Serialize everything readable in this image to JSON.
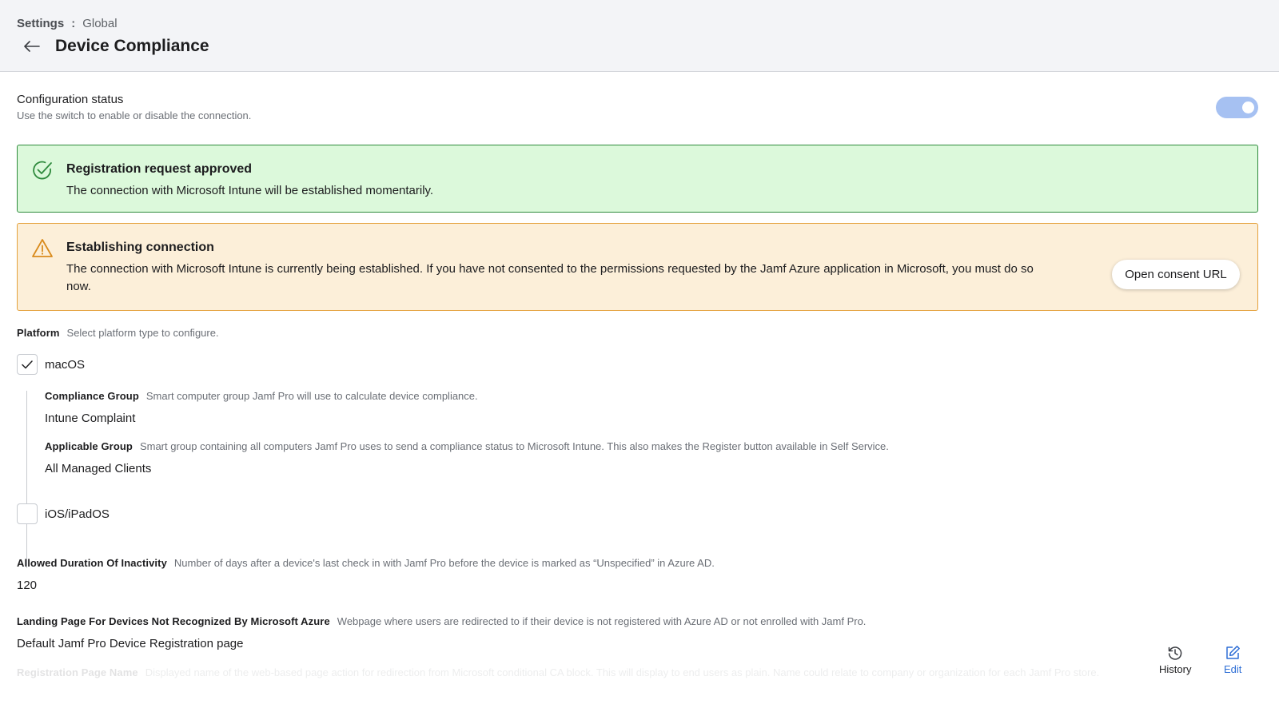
{
  "breadcrumb": {
    "root": "Settings",
    "separator": ":",
    "current": "Global"
  },
  "page": {
    "title": "Device Compliance"
  },
  "config_status": {
    "title": "Configuration status",
    "description": "Use the switch to enable or disable the connection.",
    "enabled": true
  },
  "alerts": {
    "success": {
      "title": "Registration request approved",
      "text": "The connection with Microsoft Intune will be established momentarily."
    },
    "warning": {
      "title": "Establishing connection",
      "text": "The connection with Microsoft Intune is currently being established. If you have not consented to the permissions requested by the Jamf Azure application in Microsoft, you must do so now.",
      "button_label": "Open consent URL"
    }
  },
  "platform": {
    "label": "Platform",
    "description": "Select platform type to configure.",
    "options": [
      {
        "label": "macOS",
        "checked": true
      },
      {
        "label": "iOS/iPadOS",
        "checked": false
      }
    ],
    "macos": {
      "compliance_group": {
        "label": "Compliance Group",
        "description": "Smart computer group Jamf Pro will use to calculate device compliance.",
        "value": "Intune Complaint"
      },
      "applicable_group": {
        "label": "Applicable Group",
        "description": "Smart group containing all computers Jamf Pro uses to send a compliance status to Microsoft Intune. This also makes the Register button available in Self Service.",
        "value": "All Managed Clients"
      }
    }
  },
  "inactivity": {
    "label": "Allowed Duration Of Inactivity",
    "description": "Number of days after a device's last check in with Jamf Pro before the device is marked as “Unspecified” in Azure AD.",
    "value": "120"
  },
  "landing_page": {
    "label": "Landing Page For Devices Not Recognized By Microsoft Azure",
    "description": "Webpage where users are redirected to if their device is not registered with Azure AD or not enrolled with Jamf Pro.",
    "value": "Default Jamf Pro Device Registration page"
  },
  "registration_page": {
    "label": "Registration Page Name",
    "description": "Displayed name of the web-based page action for redirection from Microsoft conditional CA block. This will display to end users as plain. Name could relate to company or organization for each Jamf Pro store."
  },
  "actions": {
    "history_label": "History",
    "edit_label": "Edit"
  },
  "colors": {
    "accent": "#2f6fd6",
    "success_bg": "#dcf9db",
    "success_border": "#2e8a3c",
    "warning_bg": "#fcefd9",
    "warning_border": "#e4a13c",
    "toggle_on": "#a6c1f2"
  },
  "icons": {
    "back": "arrow-left-icon",
    "success": "check-circle-icon",
    "warning": "warning-triangle-icon",
    "checkbox": "checkmark-icon",
    "history": "history-clock-icon",
    "edit": "edit-pencil-icon"
  }
}
